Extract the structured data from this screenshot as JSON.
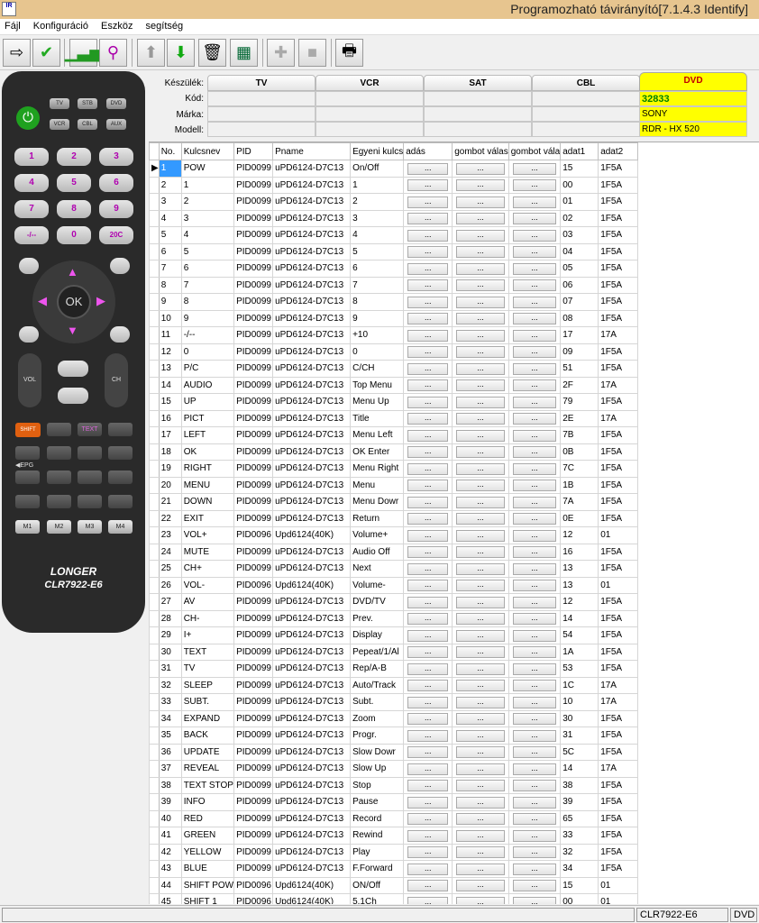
{
  "window": {
    "title": "Programozható távirányító[7.1.4.3 Identify]",
    "icon_text": "IR"
  },
  "menu": [
    "Fájl",
    "Konfiguráció",
    "Eszköz",
    "segítség"
  ],
  "remote": {
    "source_buttons": [
      "TV",
      "STB",
      "DVD",
      "VCR",
      "CBL",
      "AUX"
    ],
    "digits": [
      "1",
      "2",
      "3",
      "4",
      "5",
      "6",
      "7",
      "8",
      "9",
      "-/--",
      "0",
      "20C"
    ],
    "nav_center": "OK",
    "vol_label": "VOL",
    "ch_label": "CH",
    "func_row": [
      "SHIFT",
      "",
      "TEXT",
      ""
    ],
    "epg_label": "◀EPG",
    "m_buttons": [
      "M1",
      "M2",
      "M3",
      "M4"
    ],
    "brand": "LONGER",
    "model": "CLR7922-E6"
  },
  "device": {
    "labels": {
      "type": "Készülék:",
      "code": "Kód:",
      "brand": "Márka:",
      "model": "Modell:"
    },
    "tabs": [
      "TV",
      "VCR",
      "SAT",
      "CBL",
      "DVD"
    ],
    "active": {
      "code": "32833",
      "brand": "SONY",
      "model": "RDR - HX 520"
    },
    "colors": {
      "active_bg": "#ffff00",
      "active_text": "#c00000",
      "code_text": "#008000"
    }
  },
  "table": {
    "headers": [
      "No.",
      "Kulcsnev",
      "PID",
      "Pname",
      "Egyeni kulcs",
      "adás",
      "gombot válas",
      "gombot vála",
      "adat1",
      "adat2"
    ],
    "button_text": "...",
    "rows": [
      [
        "1",
        "POW",
        "PID0099",
        "uPD6124-D7C13",
        "On/Off",
        "15",
        "1F5A"
      ],
      [
        "2",
        "1",
        "PID0099",
        "uPD6124-D7C13",
        "1",
        "00",
        "1F5A"
      ],
      [
        "3",
        "2",
        "PID0099",
        "uPD6124-D7C13",
        "2",
        "01",
        "1F5A"
      ],
      [
        "4",
        "3",
        "PID0099",
        "uPD6124-D7C13",
        "3",
        "02",
        "1F5A"
      ],
      [
        "5",
        "4",
        "PID0099",
        "uPD6124-D7C13",
        "4",
        "03",
        "1F5A"
      ],
      [
        "6",
        "5",
        "PID0099",
        "uPD6124-D7C13",
        "5",
        "04",
        "1F5A"
      ],
      [
        "7",
        "6",
        "PID0099",
        "uPD6124-D7C13",
        "6",
        "05",
        "1F5A"
      ],
      [
        "8",
        "7",
        "PID0099",
        "uPD6124-D7C13",
        "7",
        "06",
        "1F5A"
      ],
      [
        "9",
        "8",
        "PID0099",
        "uPD6124-D7C13",
        "8",
        "07",
        "1F5A"
      ],
      [
        "10",
        "9",
        "PID0099",
        "uPD6124-D7C13",
        "9",
        "08",
        "1F5A"
      ],
      [
        "11",
        "-/--",
        "PID0099",
        "uPD6124-D7C13",
        "+10",
        "17",
        "17A"
      ],
      [
        "12",
        "0",
        "PID0099",
        "uPD6124-D7C13",
        "0",
        "09",
        "1F5A"
      ],
      [
        "13",
        "P/C",
        "PID0099",
        "uPD6124-D7C13",
        "C/CH",
        "51",
        "1F5A"
      ],
      [
        "14",
        "AUDIO",
        "PID0099",
        "uPD6124-D7C13",
        "Top Menu",
        "2F",
        "17A"
      ],
      [
        "15",
        "UP",
        "PID0099",
        "uPD6124-D7C13",
        "Menu Up",
        "79",
        "1F5A"
      ],
      [
        "16",
        "PICT",
        "PID0099",
        "uPD6124-D7C13",
        "Title",
        "2E",
        "17A"
      ],
      [
        "17",
        "LEFT",
        "PID0099",
        "uPD6124-D7C13",
        "Menu Left",
        "7B",
        "1F5A"
      ],
      [
        "18",
        "OK",
        "PID0099",
        "uPD6124-D7C13",
        "OK Enter",
        "0B",
        "1F5A"
      ],
      [
        "19",
        "RIGHT",
        "PID0099",
        "uPD6124-D7C13",
        "Menu Right",
        "7C",
        "1F5A"
      ],
      [
        "20",
        "MENU",
        "PID0099",
        "uPD6124-D7C13",
        "Menu",
        "1B",
        "1F5A"
      ],
      [
        "21",
        "DOWN",
        "PID0099",
        "uPD6124-D7C13",
        "Menu Dowr",
        "7A",
        "1F5A"
      ],
      [
        "22",
        "EXIT",
        "PID0099",
        "uPD6124-D7C13",
        "Return",
        "0E",
        "1F5A"
      ],
      [
        "23",
        "VOL+",
        "PID0096",
        "Upd6124(40K)",
        "Volume+",
        "12",
        "01"
      ],
      [
        "24",
        "MUTE",
        "PID0099",
        "uPD6124-D7C13",
        "Audio Off",
        "16",
        "1F5A"
      ],
      [
        "25",
        "CH+",
        "PID0099",
        "uPD6124-D7C13",
        "Next",
        "13",
        "1F5A"
      ],
      [
        "26",
        "VOL-",
        "PID0096",
        "Upd6124(40K)",
        "Volume-",
        "13",
        "01"
      ],
      [
        "27",
        "AV",
        "PID0099",
        "uPD6124-D7C13",
        "DVD/TV",
        "12",
        "1F5A"
      ],
      [
        "28",
        "CH-",
        "PID0099",
        "uPD6124-D7C13",
        "Prev.",
        "14",
        "1F5A"
      ],
      [
        "29",
        "I+",
        "PID0099",
        "uPD6124-D7C13",
        "Display",
        "54",
        "1F5A"
      ],
      [
        "30",
        "TEXT",
        "PID0099",
        "uPD6124-D7C13",
        "Pepeat/1/Al",
        "1A",
        "1F5A"
      ],
      [
        "31",
        "TV",
        "PID0099",
        "uPD6124-D7C13",
        "Rep/A-B",
        "53",
        "1F5A"
      ],
      [
        "32",
        "SLEEP",
        "PID0099",
        "uPD6124-D7C13",
        "Auto/Track",
        "1C",
        "17A"
      ],
      [
        "33",
        "SUBT.",
        "PID0099",
        "uPD6124-D7C13",
        "Subt.",
        "10",
        "17A"
      ],
      [
        "34",
        "EXPAND",
        "PID0099",
        "uPD6124-D7C13",
        "Zoom",
        "30",
        "1F5A"
      ],
      [
        "35",
        "BACK",
        "PID0099",
        "uPD6124-D7C13",
        "Progr.",
        "31",
        "1F5A"
      ],
      [
        "36",
        "UPDATE",
        "PID0099",
        "uPD6124-D7C13",
        "Slow Dowr",
        "5C",
        "1F5A"
      ],
      [
        "37",
        "REVEAL",
        "PID0099",
        "uPD6124-D7C13",
        "Slow Up",
        "14",
        "17A"
      ],
      [
        "38",
        "TEXT STOP",
        "PID0099",
        "uPD6124-D7C13",
        "Stop",
        "38",
        "1F5A"
      ],
      [
        "39",
        "INFO",
        "PID0099",
        "uPD6124-D7C13",
        "Pause",
        "39",
        "1F5A"
      ],
      [
        "40",
        "RED",
        "PID0099",
        "uPD6124-D7C13",
        "Record",
        "65",
        "1F5A"
      ],
      [
        "41",
        "GREEN",
        "PID0099",
        "uPD6124-D7C13",
        "Rewind",
        "33",
        "1F5A"
      ],
      [
        "42",
        "YELLOW",
        "PID0099",
        "uPD6124-D7C13",
        "Play",
        "32",
        "1F5A"
      ],
      [
        "43",
        "BLUE",
        "PID0099",
        "uPD6124-D7C13",
        "F.Forward",
        "34",
        "1F5A"
      ],
      [
        "44",
        "SHIFT POW",
        "PID0096",
        "Upd6124(40K)",
        "ON/Off",
        "15",
        "01"
      ],
      [
        "45",
        "SHIFT 1",
        "PID0096",
        "Upd6124(40K)",
        "5.1Ch",
        "00",
        "01"
      ]
    ]
  },
  "status": {
    "model": "CLR7922-E6",
    "device": "DVD"
  }
}
